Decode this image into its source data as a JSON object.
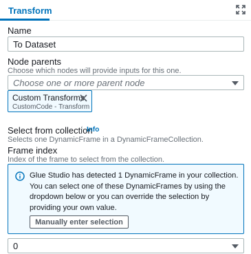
{
  "panel": {
    "tab_label": "Transform",
    "expand_icon": "expand-icon"
  },
  "name_field": {
    "label": "Name",
    "value": "To Dataset"
  },
  "node_parents": {
    "label": "Node parents",
    "description": "Choose which nodes will provide inputs for this one.",
    "placeholder": "Choose one or more parent node",
    "selected_token": {
      "title": "Custom Transforms",
      "subtitle": "CustomCode - Transform",
      "remove_icon": "close-icon"
    }
  },
  "collection": {
    "label": "Select from collection",
    "info_link": "Info",
    "description": "Selects one DynamicFrame in a DynamicFrameCollection."
  },
  "frame_index": {
    "label": "Frame index",
    "description": "Index of the frame to select from the collection.",
    "alert_text": "Glue Studio has detected 1 DynamicFrame in your collection. You can select one of these DynamicFrames by using the dropdown below or you can override the selection by providing your own value.",
    "alert_button": "Manually enter selection",
    "selected_value": "0"
  },
  "colors": {
    "accent": "#0073bb",
    "alert_bg": "#f1faff",
    "text": "#16191f",
    "muted": "#687078"
  }
}
